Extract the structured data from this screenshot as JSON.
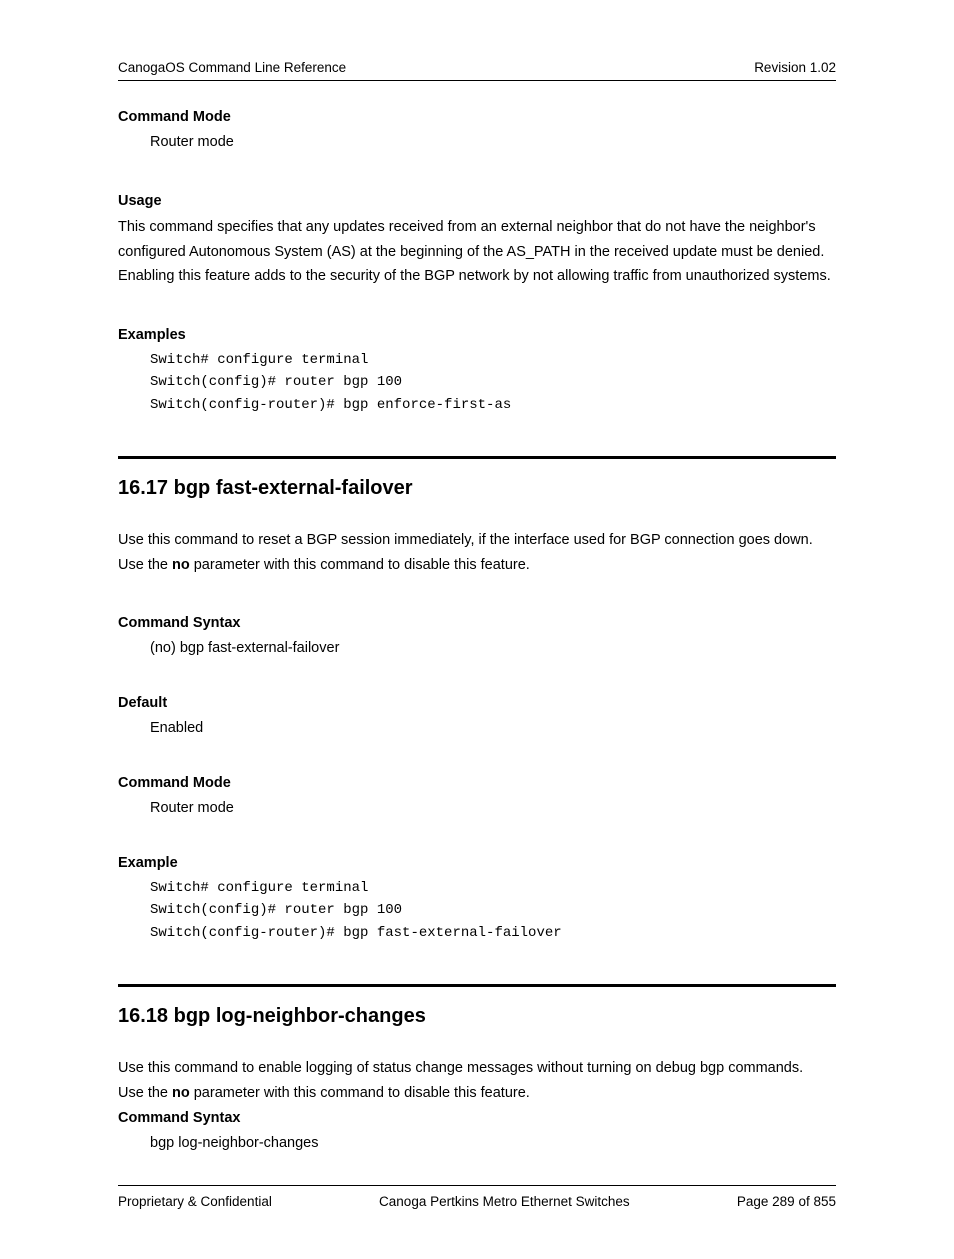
{
  "header": {
    "left": "CanogaOS Command Line Reference",
    "right": "Revision 1.02"
  },
  "sec1": {
    "cmd_mode_h": "Command Mode",
    "cmd_mode_v": "Router mode",
    "usage_h": "Usage",
    "usage_p1": "This command specifies that any updates received from an external neighbor that do not have the neighbor's configured Autonomous System (AS) at the beginning of the AS_PATH in the received update must be denied.",
    "usage_p2": "Enabling this feature adds to the security of the BGP network by not allowing traffic from unauthorized systems.",
    "examples_h": "Examples",
    "examples_code": "Switch# configure terminal\nSwitch(config)# router bgp 100\nSwitch(config-router)# bgp enforce-first-as"
  },
  "sec2": {
    "title": "16.17  bgp fast-external-failover",
    "intro_p1": "Use this command to reset a BGP session immediately, if the interface used for BGP connection goes down.",
    "intro_p2a": "Use the ",
    "intro_p2b": "no",
    "intro_p2c": " parameter with this command to disable this feature.",
    "syntax_h": "Command Syntax",
    "syntax_v": "(no) bgp fast-external-failover",
    "default_h": "Default",
    "default_v": "Enabled",
    "cmd_mode_h": "Command Mode",
    "cmd_mode_v": "Router mode",
    "example_h": "Example",
    "example_code": "Switch# configure terminal\nSwitch(config)# router bgp 100\nSwitch(config-router)# bgp fast-external-failover"
  },
  "sec3": {
    "title": "16.18  bgp log-neighbor-changes",
    "intro_p1": "Use this command to enable logging of status change messages without turning on debug bgp commands.",
    "intro_p2a": "Use the ",
    "intro_p2b": "no",
    "intro_p2c": " parameter with this command to disable this feature.",
    "syntax_h": "Command Syntax",
    "syntax_v": "bgp log-neighbor-changes"
  },
  "footer": {
    "left": "Proprietary & Confidential",
    "center": "Canoga Pertkins Metro Ethernet Switches",
    "right": "Page 289 of 855"
  }
}
